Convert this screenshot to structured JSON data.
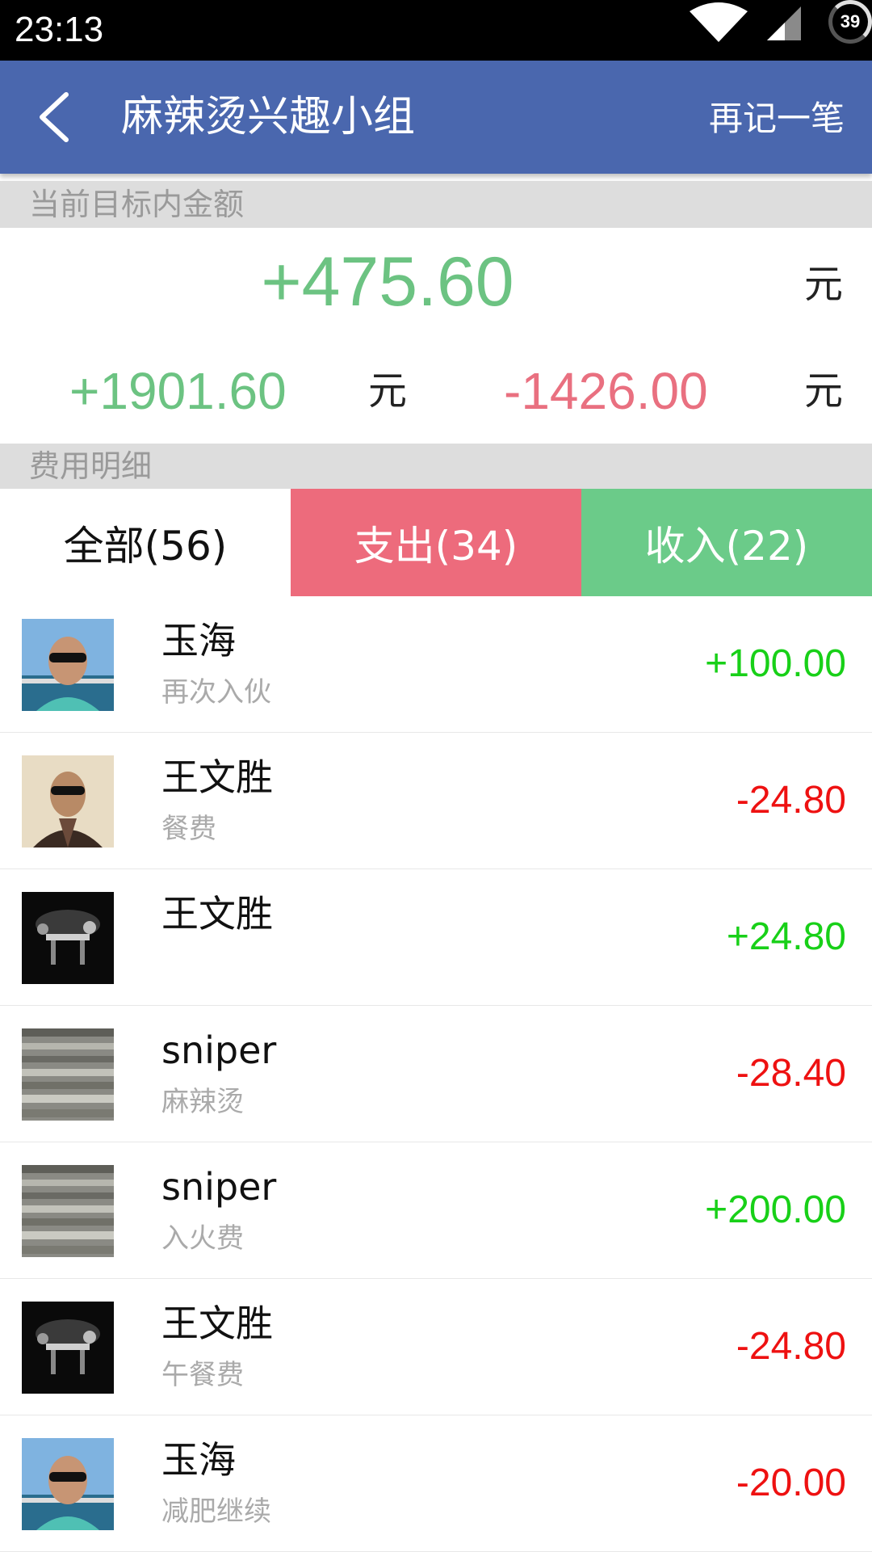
{
  "status_bar": {
    "time": "23:13",
    "battery_level": "39",
    "icons": [
      "wifi-icon",
      "signal-icon",
      "battery-icon"
    ]
  },
  "app_bar": {
    "back_icon": "back-arrow-icon",
    "title": "麻辣烫兴趣小组",
    "action_label": "再记一笔"
  },
  "summary": {
    "header": "当前目标内金额",
    "total": "+475.60",
    "total_unit": "元",
    "income_total": "+1901.60",
    "income_unit": "元",
    "expense_total": "-1426.00",
    "expense_unit": "元"
  },
  "details": {
    "header": "费用明细",
    "tabs": [
      {
        "label": "全部(56)"
      },
      {
        "label": "支出(34)"
      },
      {
        "label": "收入(22)"
      }
    ],
    "records": [
      {
        "name": "玉海",
        "note": "再次入伙",
        "amount": "+100.00",
        "type": "income"
      },
      {
        "name": "王文胜",
        "note": "餐费",
        "amount": "-24.80",
        "type": "expense"
      },
      {
        "name": "王文胜",
        "note": "",
        "amount": "+24.80",
        "type": "income"
      },
      {
        "name": "sniper",
        "note": "麻辣烫",
        "amount": "-28.40",
        "type": "expense"
      },
      {
        "name": "sniper",
        "note": "入火费",
        "amount": "+200.00",
        "type": "income"
      },
      {
        "name": "王文胜",
        "note": "午餐费",
        "amount": "-24.80",
        "type": "expense"
      },
      {
        "name": "玉海",
        "note": "减肥继续",
        "amount": "-20.00",
        "type": "expense"
      }
    ]
  },
  "colors": {
    "app_bar": "#4a67ae",
    "positive_summary": "#6cc382",
    "negative_summary": "#e97080",
    "tab_expense": "#ed6b7c",
    "tab_income": "#6bcb89",
    "record_income": "#18d018",
    "record_expense": "#ee1111"
  }
}
